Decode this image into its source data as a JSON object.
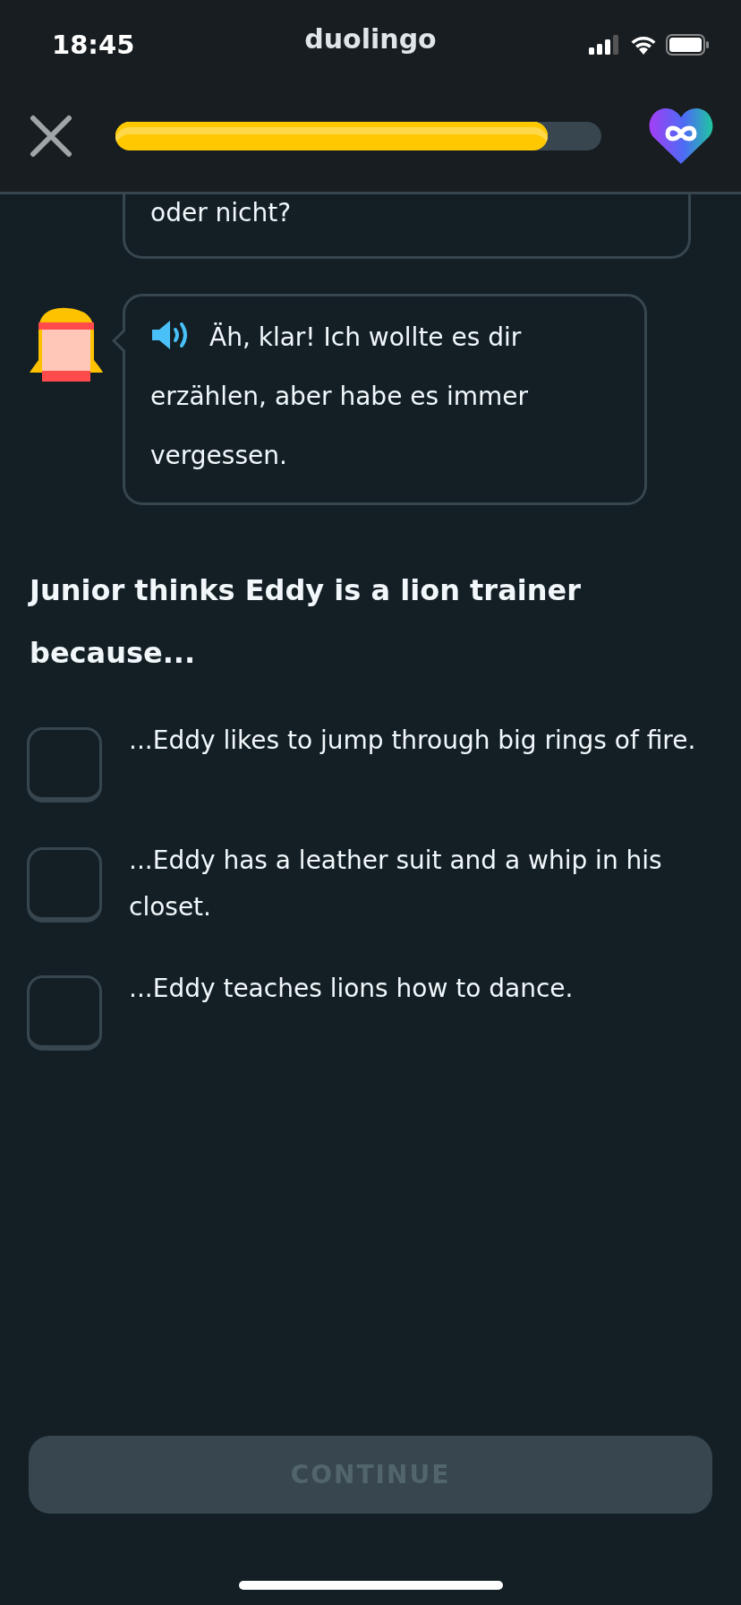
{
  "status_bar": {
    "time": "18:45",
    "app": "duolingo"
  },
  "header": {
    "progress": {
      "level": 0.89
    }
  },
  "conversation": [
    {
      "text": "oder nicht?",
      "kind": "partial"
    },
    {
      "text": "Äh, klar! Ich wollte es dir erzählen, aber habe es immer vergessen.",
      "kind": "avatar"
    }
  ],
  "question": "Junior thinks Eddy is a lion trainer because...",
  "options": [
    {
      "label": "...Eddy likes to jump through big rings of fire.",
      "checked": false
    },
    {
      "label": "...Eddy has a leather suit and a whip in his closet.",
      "checked": false
    },
    {
      "label": "...Eddy teaches lions how to dance.",
      "checked": false
    }
  ],
  "continue_button": {
    "label": "CONTINUE",
    "disabled": true
  }
}
